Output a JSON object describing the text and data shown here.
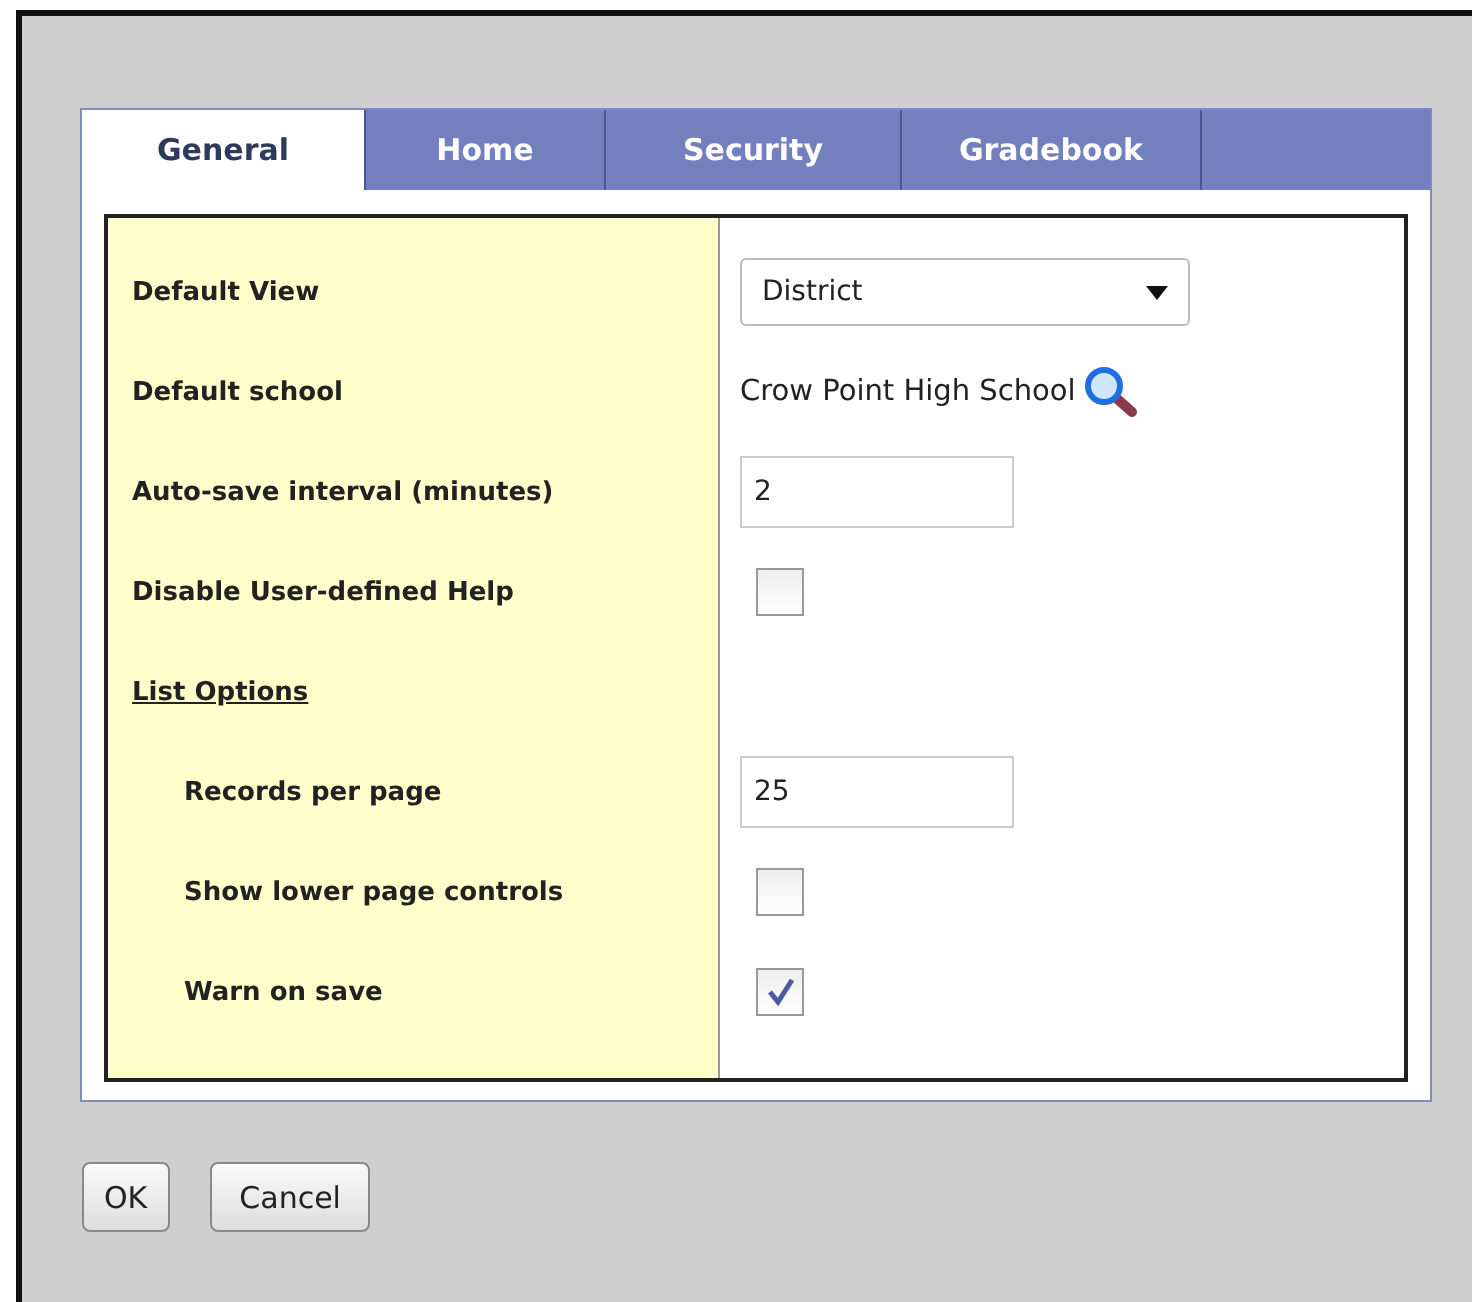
{
  "tabs": [
    {
      "label": "General",
      "selected": true
    },
    {
      "label": "Home",
      "selected": false
    },
    {
      "label": "Security",
      "selected": false
    },
    {
      "label": "Gradebook",
      "selected": false
    }
  ],
  "fields": [
    {
      "kind": "select",
      "label": "Default View",
      "value": "District"
    },
    {
      "kind": "lookup",
      "label": "Default school",
      "value": "Crow Point High School"
    },
    {
      "kind": "input",
      "label": "Auto-save interval (minutes)",
      "value": "2"
    },
    {
      "kind": "checkbox",
      "label": "Disable User-defined Help",
      "checked": false
    },
    {
      "kind": "section",
      "label": "List Options",
      "children": [
        {
          "kind": "input",
          "label": "Records per page",
          "value": "25"
        },
        {
          "kind": "checkbox",
          "label": "Show lower page controls",
          "checked": false
        },
        {
          "kind": "checkbox",
          "label": "Warn on save",
          "checked": true
        }
      ]
    }
  ],
  "buttons": [
    "OK",
    "Cancel"
  ]
}
